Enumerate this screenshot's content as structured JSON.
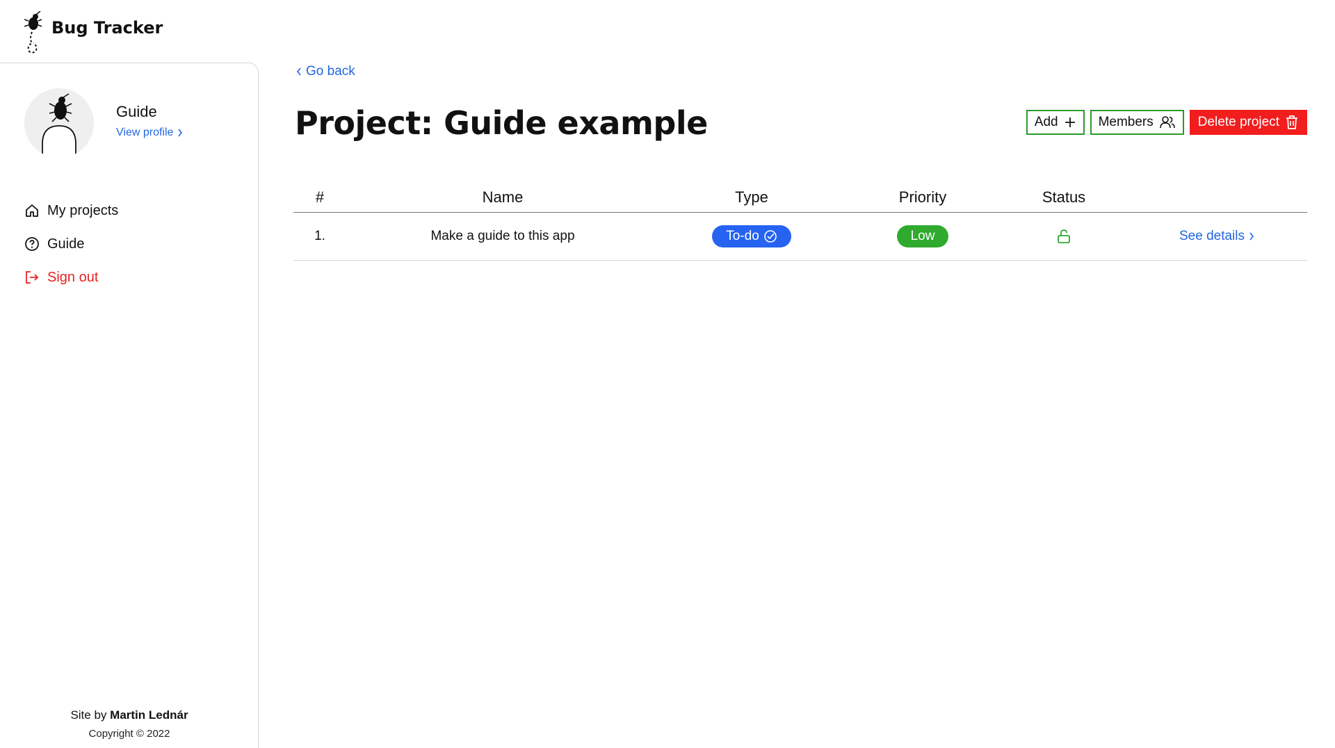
{
  "app": {
    "title": "Bug Tracker",
    "logo_icon": "bug-logo-icon"
  },
  "profile": {
    "name": "Guide",
    "view_profile_label": "View profile"
  },
  "nav": {
    "items": [
      {
        "label": "My projects",
        "icon": "home-icon"
      },
      {
        "label": "Guide",
        "icon": "question-circle-icon"
      },
      {
        "label": "Sign out",
        "icon": "sign-out-icon",
        "color": "#e52222"
      }
    ]
  },
  "footer": {
    "site_by_prefix": "Site by",
    "author": "Martin Lednár",
    "copyright": "Copyright © 2022"
  },
  "main": {
    "go_back_label": "Go back",
    "title": "Project: Guide example",
    "actions": {
      "add_label": "Add",
      "members_label": "Members",
      "delete_label": "Delete project"
    },
    "table": {
      "columns": [
        "#",
        "Name",
        "Type",
        "Priority",
        "Status",
        ""
      ],
      "rows": [
        {
          "num": "1.",
          "name": "Make a guide to this app",
          "type": "To-do",
          "priority": "Low",
          "status_icon": "unlocked-icon",
          "details_label": "See details"
        }
      ]
    }
  },
  "colors": {
    "accent_blue": "#2266e0",
    "type_pill": "#2563f0",
    "priority_low": "#2faa2f",
    "danger": "#f21d1d",
    "success_border": "#2a9b2a"
  }
}
